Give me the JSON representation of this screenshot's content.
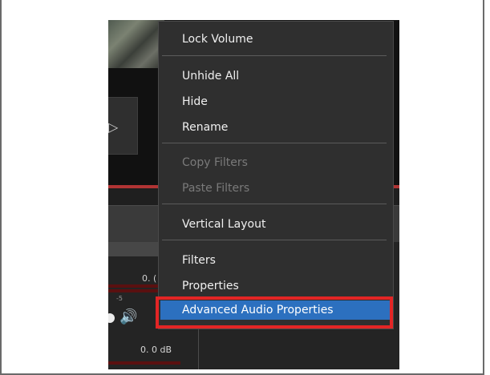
{
  "mixer": {
    "db_top": "0. (",
    "db_bottom": "0. 0 dB",
    "tick_label": "-5"
  },
  "context_menu": {
    "lock_volume": "Lock Volume",
    "unhide_all": "Unhide All",
    "hide": "Hide",
    "rename": "Rename",
    "copy_filters": "Copy Filters",
    "paste_filters": "Paste Filters",
    "vertical_layout": "Vertical Layout",
    "filters": "Filters",
    "properties": "Properties",
    "advanced_audio_properties": "Advanced Audio Properties"
  },
  "colors": {
    "menu_bg": "#2f2f2f",
    "highlight_bg": "#2c70bf",
    "annotation_red": "#e32525"
  }
}
